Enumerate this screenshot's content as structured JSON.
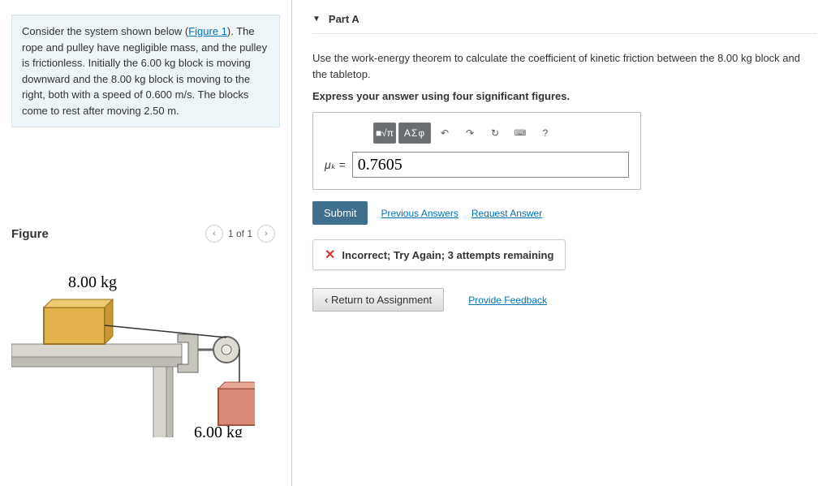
{
  "problem": {
    "text_before_link": "Consider the system shown below (",
    "figure_link": "Figure 1",
    "text_after_link": "). The rope and pulley have negligible mass, and the pulley is frictionless. Initially the 6.00 kg block is moving downward and the 8.00 kg block is moving to the right, both with a speed of 0.600 m/s. The blocks come to rest after moving 2.50 m."
  },
  "figure": {
    "title": "Figure",
    "pager": "1 of 1",
    "mass_top": "8.00 kg",
    "mass_hanging": "6.00 kg"
  },
  "part": {
    "label": "Part A",
    "question": "Use the work-energy theorem to calculate the coefficient of kinetic friction between the 8.00 kg block and the tabletop.",
    "instruction": "Express your answer using four significant figures.",
    "toolbar": {
      "templates": "■√π",
      "greek": "ΑΣφ",
      "undo": "↶",
      "redo": "↷",
      "reset": "↻",
      "keyboard": "⌨",
      "help": "?"
    },
    "answer_label": "μₖ =",
    "answer_value": "0.7605",
    "submit": "Submit",
    "prev_answers": "Previous Answers",
    "request_answer": "Request Answer",
    "feedback": "Incorrect; Try Again; 3 attempts remaining"
  },
  "footer": {
    "return": "Return to Assignment",
    "provide_feedback": "Provide Feedback"
  }
}
